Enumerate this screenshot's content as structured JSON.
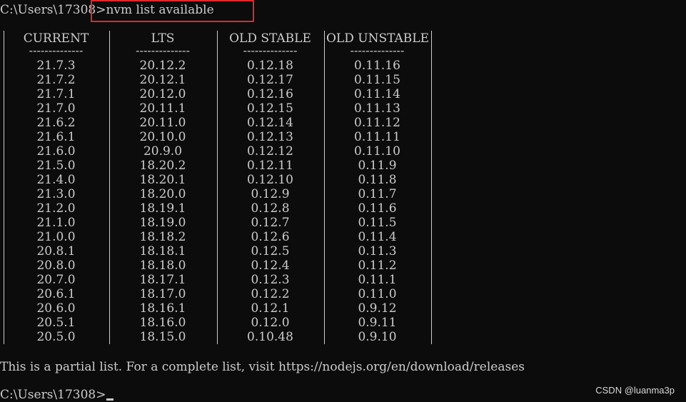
{
  "prompt_top": {
    "path": "C:\\Users\\17308>",
    "command": "nvm list available"
  },
  "columns": [
    {
      "header": "CURRENT",
      "dashes": "--------------",
      "values": [
        "21.7.3",
        "21.7.2",
        "21.7.1",
        "21.7.0",
        "21.6.2",
        "21.6.1",
        "21.6.0",
        "21.5.0",
        "21.4.0",
        "21.3.0",
        "21.2.0",
        "21.1.0",
        "21.0.0",
        "20.8.1",
        "20.8.0",
        "20.7.0",
        "20.6.1",
        "20.6.0",
        "20.5.1",
        "20.5.0"
      ]
    },
    {
      "header": "LTS",
      "dashes": "--------------",
      "values": [
        "20.12.2",
        "20.12.1",
        "20.12.0",
        "20.11.1",
        "20.11.0",
        "20.10.0",
        "20.9.0",
        "18.20.2",
        "18.20.1",
        "18.20.0",
        "18.19.1",
        "18.19.0",
        "18.18.2",
        "18.18.1",
        "18.18.0",
        "18.17.1",
        "18.17.0",
        "18.16.1",
        "18.16.0",
        "18.15.0"
      ]
    },
    {
      "header": "OLD STABLE",
      "dashes": "--------------",
      "values": [
        "0.12.18",
        "0.12.17",
        "0.12.16",
        "0.12.15",
        "0.12.14",
        "0.12.13",
        "0.12.12",
        "0.12.11",
        "0.12.10",
        "0.12.9",
        "0.12.8",
        "0.12.7",
        "0.12.6",
        "0.12.5",
        "0.12.4",
        "0.12.3",
        "0.12.2",
        "0.12.1",
        "0.12.0",
        "0.10.48"
      ]
    },
    {
      "header": "OLD UNSTABLE",
      "dashes": "--------------",
      "values": [
        "0.11.16",
        "0.11.15",
        "0.11.14",
        "0.11.13",
        "0.11.12",
        "0.11.11",
        "0.11.10",
        "0.11.9",
        "0.11.8",
        "0.11.7",
        "0.11.6",
        "0.11.5",
        "0.11.4",
        "0.11.3",
        "0.11.2",
        "0.11.1",
        "0.11.0",
        "0.9.12",
        "0.9.11",
        "0.9.10"
      ]
    }
  ],
  "footer_message": "This is a partial list. For a complete list, visit https://nodejs.org/en/download/releases",
  "prompt_bottom": {
    "path": "C:\\Users\\17308>"
  },
  "watermark": "CSDN @luanma3p",
  "colors": {
    "background": "#0c0c0c",
    "text": "#cccccc",
    "highlight": "#e0282e"
  }
}
